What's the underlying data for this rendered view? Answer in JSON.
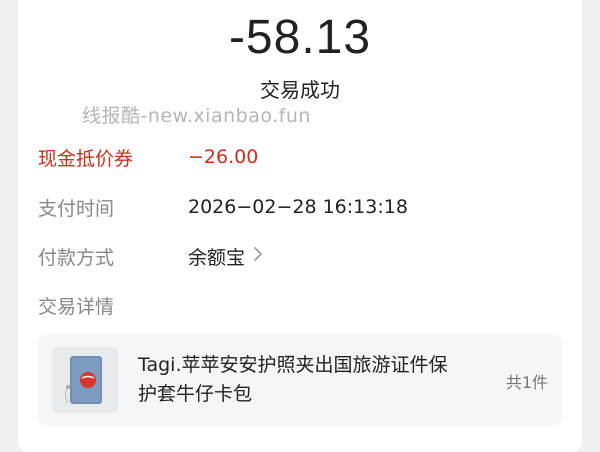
{
  "amount": "-58.13",
  "status": "交易成功",
  "watermark": "线报酷-new.xianbao.fun",
  "details": [
    {
      "label": "现金抵价券",
      "value": "−26.00"
    },
    {
      "label": "支付时间",
      "value": "2026−02−28 16:13:18"
    },
    {
      "label": "付款方式",
      "value": "余额宝"
    }
  ],
  "trade_detail_label": "交易详情",
  "product": {
    "name": "Tagi.苹苹安安护照夹出国旅游证件保护套牛仔卡包",
    "quantity": "共1件"
  },
  "colors": {
    "accent_red": "#c8321f",
    "label_gray": "#888888",
    "text_dark": "#222222"
  },
  "icons": {
    "payment_chevron": "chevron-right-icon"
  }
}
